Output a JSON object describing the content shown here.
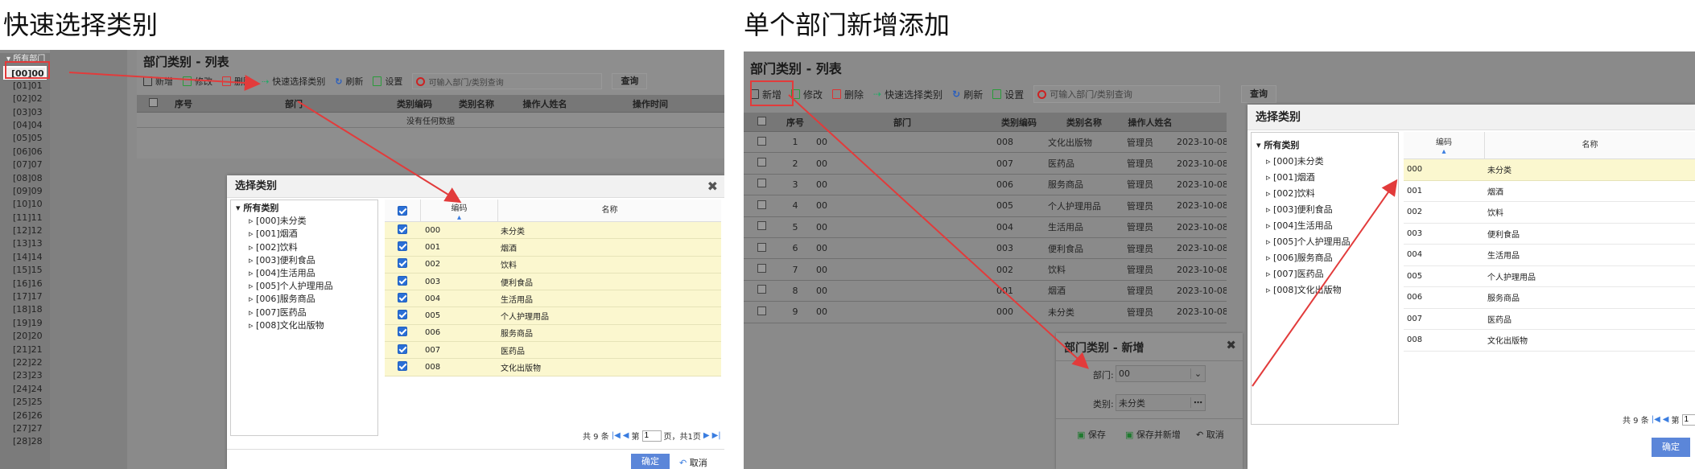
{
  "left_heading": "快速选择类别",
  "right_heading": "单个部门新增添加",
  "left_tree": {
    "root": "所有部门",
    "items": [
      "[00]00",
      "[01]01",
      "[02]02",
      "[03]03",
      "[04]04",
      "[05]05",
      "[06]06",
      "[07]07",
      "[08]08",
      "[09]09",
      "[10]10",
      "[11]11",
      "[12]12",
      "[13]13",
      "[14]14",
      "[15]15",
      "[16]16",
      "[17]17",
      "[18]18",
      "[19]19",
      "[20]20",
      "[21]21",
      "[22]22",
      "[23]23",
      "[24]24",
      "[25]25",
      "[26]26",
      "[27]27",
      "[28]28"
    ]
  },
  "list": {
    "title": "部门类别 - 列表",
    "toolbar": {
      "add": "新增",
      "edit": "修改",
      "delete": "删除",
      "quick_select": "快速选择类别",
      "refresh": "刷新",
      "settings": "设置",
      "search_placeholder": "可输入部门/类别查询",
      "query": "查询"
    },
    "columns": [
      "序号",
      "部门",
      "类别编码",
      "类别名称",
      "操作人姓名",
      "操作时间"
    ],
    "empty_text": "没有任何数据",
    "rows": [
      [
        "1",
        "00",
        "008",
        "文化出版物",
        "管理员",
        "2023-10-08"
      ],
      [
        "2",
        "00",
        "007",
        "医药品",
        "管理员",
        "2023-10-08"
      ],
      [
        "3",
        "00",
        "006",
        "服务商品",
        "管理员",
        "2023-10-08"
      ],
      [
        "4",
        "00",
        "005",
        "个人护理用品",
        "管理员",
        "2023-10-08"
      ],
      [
        "5",
        "00",
        "004",
        "生活用品",
        "管理员",
        "2023-10-08"
      ],
      [
        "6",
        "00",
        "003",
        "便利食品",
        "管理员",
        "2023-10-08"
      ],
      [
        "7",
        "00",
        "002",
        "饮料",
        "管理员",
        "2023-10-08"
      ],
      [
        "8",
        "00",
        "001",
        "烟酒",
        "管理员",
        "2023-10-08"
      ],
      [
        "9",
        "00",
        "000",
        "未分类",
        "管理员",
        "2023-10-08"
      ]
    ]
  },
  "select_dialog": {
    "title": "选择类别",
    "tree_root": "所有类别",
    "tree_items": [
      "[000]未分类",
      "[001]烟酒",
      "[002]饮料",
      "[003]便利食品",
      "[004]生活用品",
      "[005]个人护理用品",
      "[006]服务商品",
      "[007]医药品",
      "[008]文化出版物"
    ],
    "col_code": "编码",
    "col_name": "名称",
    "rows": [
      [
        "000",
        "未分类"
      ],
      [
        "001",
        "烟酒"
      ],
      [
        "002",
        "饮料"
      ],
      [
        "003",
        "便利食品"
      ],
      [
        "004",
        "生活用品"
      ],
      [
        "005",
        "个人护理用品"
      ],
      [
        "006",
        "服务商品"
      ],
      [
        "007",
        "医药品"
      ],
      [
        "008",
        "文化出版物"
      ]
    ],
    "pager": {
      "total": "共 9 条",
      "page_prefix": "第",
      "page": "1",
      "page_suffix": "页，共1页",
      "page_suffix_cut": "页，"
    },
    "ok": "确定",
    "cancel": "取消"
  },
  "add_dialog": {
    "title": "部门类别 - 新增",
    "dept_label": "部门:",
    "dept_value": "00",
    "cat_label": "类别:",
    "cat_value": "未分类",
    "save": "保存",
    "save_new": "保存并新增",
    "cancel": "取消"
  },
  "colors": {
    "arrow": "#e23b3b",
    "highlight_row": "#fbf7cf",
    "primary_button": "#5b86d9"
  }
}
